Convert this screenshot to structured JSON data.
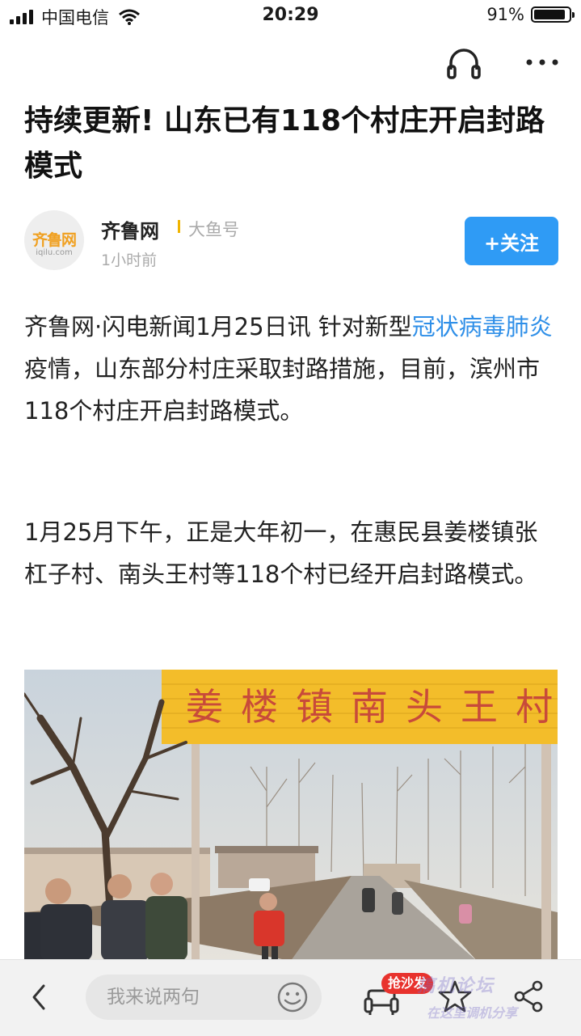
{
  "status_bar": {
    "carrier": "中国电信",
    "time": "20:29",
    "battery": "91%",
    "battery_level": 0.91
  },
  "article": {
    "title": "持续更新! 山东已有118个村庄开启封路模式",
    "source": {
      "logo_text": "齐鲁网",
      "logo_domain": "iqilu.com",
      "name": "齐鲁网",
      "platform": "大鱼号",
      "time": "1小时前",
      "follow_label": "+关注"
    },
    "paragraph1": {
      "lead": "齐鲁网·闪电新闻1月25日讯 针对新型",
      "link": "冠状病毒肺炎",
      "rest": "疫情，山东部分村庄采取封路措施，目前，滨州市118个村庄开启封路模式。"
    },
    "paragraph2": "1月25月下午，正是大年初一，在惠民县姜楼镇张杠子村、南头王村等118个村已经开启封路模式。",
    "photo": {
      "sign_text": "姜楼镇南头王村"
    }
  },
  "bottom_bar": {
    "comment_placeholder": "我来说两句",
    "sofa_badge": "抢沙发",
    "watermark": "搞机论坛",
    "watermark_sub": "在这里调机分享"
  },
  "colors": {
    "accent": "#2f9bf5",
    "link": "#2f8fe8",
    "badge": "#e8322d",
    "logo": "#f0a020"
  },
  "icons": [
    "signal-icon",
    "wifi-icon",
    "battery-icon",
    "headphone-icon",
    "more-icon",
    "back-icon",
    "smile-icon",
    "sofa-icon",
    "star-icon",
    "share-icon"
  ]
}
